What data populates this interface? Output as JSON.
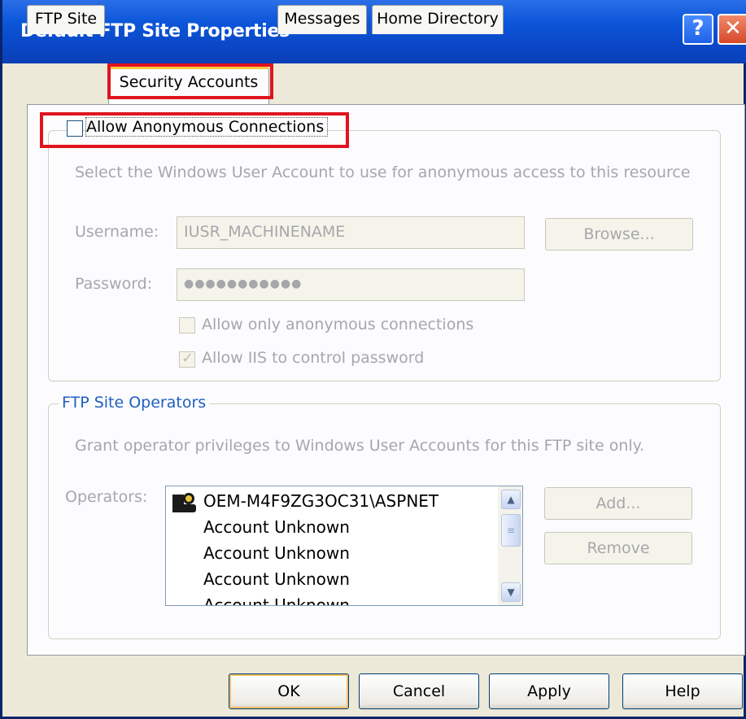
{
  "window": {
    "title": "Default FTP Site Properties",
    "help_glyph": "?",
    "close_glyph": "✕"
  },
  "tabs": [
    {
      "label": "FTP Site",
      "active": false
    },
    {
      "label": "Security Accounts",
      "active": true
    },
    {
      "label": "Messages",
      "active": false
    },
    {
      "label": "Home Directory",
      "active": false
    }
  ],
  "anonymous": {
    "checkbox_label": "Allow Anonymous Connections",
    "checked": false,
    "description": "Select the Windows User Account to use for anonymous access to this resource",
    "username_label": "Username:",
    "username_value": "IUSR_MACHINENAME",
    "browse_label": "Browse...",
    "password_label": "Password:",
    "password_value": "●●●●●●●●●●●",
    "only_anonymous_label": "Allow only anonymous connections",
    "only_anonymous_checked": false,
    "iis_control_label": "Allow IIS to control password",
    "iis_control_checked": true
  },
  "operators": {
    "group_title": "FTP Site Operators",
    "description": "Grant operator privileges to Windows User Accounts for this FTP site only.",
    "label": "Operators:",
    "items": [
      "OEM-M4F9ZG3OC31\\ASPNET",
      "Account Unknown",
      "Account Unknown",
      "Account Unknown",
      "Account Unknown"
    ],
    "add_label": "Add...",
    "remove_label": "Remove"
  },
  "footer": {
    "ok_label": "OK",
    "cancel_label": "Cancel",
    "apply_label": "Apply",
    "help_label": "Help"
  },
  "colors": {
    "highlight": "#e0141e",
    "titlebar": "#0a48c8",
    "dialog_bg": "#ece9d8",
    "group_title": "#1f5fbf"
  }
}
